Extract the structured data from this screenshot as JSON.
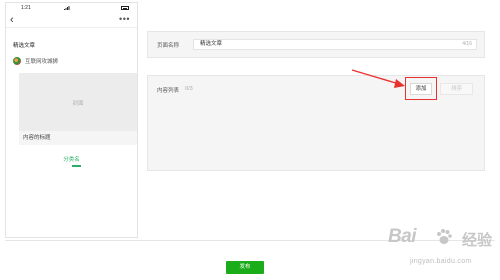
{
  "phone": {
    "status_time": "1:21",
    "nav_back_icon": "chevron-left-icon",
    "nav_more_icon": "more-dots-icon",
    "nav_more": "•••",
    "page_title": "精选文章",
    "author_name": "互联网攻城狮",
    "card": {
      "cover_text": "封面",
      "title": "内容的标题"
    },
    "group_label": "分类名"
  },
  "page_name": {
    "label": "页面名称",
    "value": "精选文章",
    "count": "4/16"
  },
  "content_list": {
    "label": "内容列表",
    "count": "0/3",
    "add_label": "添加",
    "sort_label": "排序"
  },
  "footer": {
    "publish_label": "发布"
  },
  "watermark": {
    "brand": "Bai",
    "brand_cn": "经验",
    "url": "jingyan.baidu.com"
  },
  "colors": {
    "accent_green": "#1aad19",
    "tab_green": "#2aae67",
    "annotation_red": "#e8322f"
  }
}
